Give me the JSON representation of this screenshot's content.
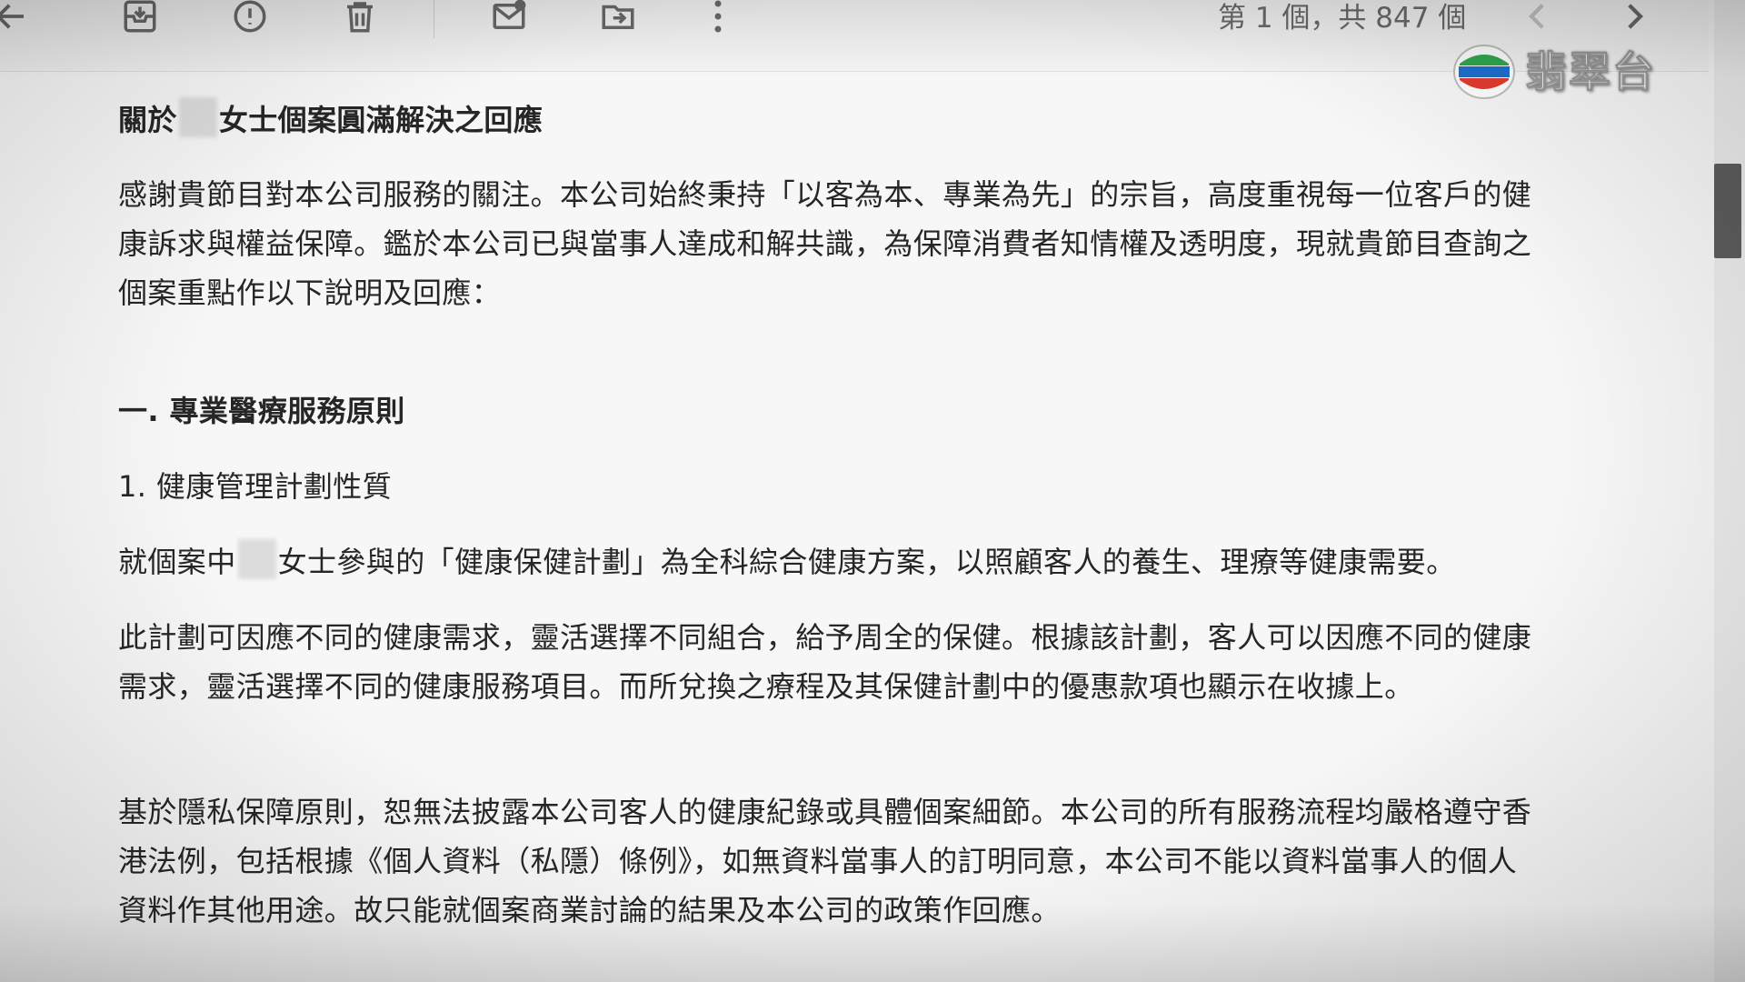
{
  "toolbar": {
    "back_icon": "arrow-left-icon",
    "archive_icon": "archive-icon",
    "spam_icon": "report-spam-icon",
    "delete_icon": "trash-icon",
    "mark_unread_icon": "mail-unread-icon",
    "move_to_icon": "move-to-folder-icon",
    "more_icon": "more-vertical-icon",
    "pagination": "第 1 個，共 847 個",
    "prev_icon": "chevron-left-icon",
    "next_icon": "chevron-right-icon"
  },
  "logo": {
    "text": "翡翠台",
    "colors": [
      "#2fa84f",
      "#1e6fd0",
      "#e33b2f"
    ]
  },
  "email": {
    "subject_prefix": "關於",
    "subject_suffix": "女士個案圓滿解決之回應",
    "intro_lines": [
      "感謝貴節目對本公司服務的關注。本公司始終秉持「以客為本、專業為先」的宗旨，高度重視每一位客戶的健",
      "康訴求與權益保障。鑑於本公司已與當事人達成和解共識，為保障消費者知情權及透明度，現就貴節目查詢之",
      "個案重點作以下說明及回應："
    ],
    "section_heading": "一. 專業醫療服務原則",
    "subheading": "1. 健康管理計劃性質",
    "plan_prefix": "就個案中",
    "plan_suffix": "女士參與的「健康保健計劃」為全科綜合健康方案，以照顧客人的養生、理療等健康需要。",
    "flex_lines": [
      "此計劃可因應不同的健康需求，靈活選擇不同組合，給予周全的保健。根據該計劃，客人可以因應不同的健康",
      "需求，靈活選擇不同的健康服務項目。而所兌換之療程及其保健計劃中的優惠款項也顯示在收據上。"
    ],
    "privacy_lines": [
      "基於隱私保障原則，恕無法披露本公司客人的健康紀錄或具體個案細節。本公司的所有服務流程均嚴格遵守香",
      "港法例，包括根據《個人資料（私隱）條例》，如無資料當事人的訂明同意，本公司不能以資料當事人的個人",
      "資料作其他用途。故只能就個案商業討論的結果及本公司的政策作回應。"
    ]
  }
}
